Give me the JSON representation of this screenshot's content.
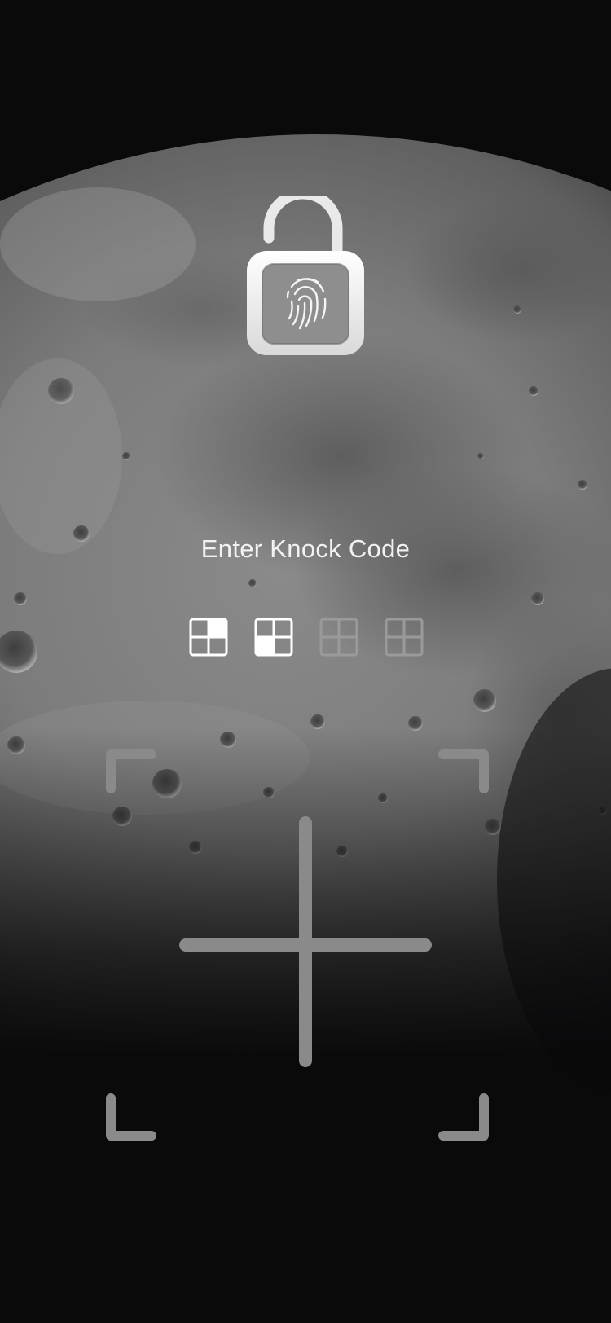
{
  "screen": {
    "wallpaper": "moon-surface",
    "accent_color": "#ffffff"
  },
  "lock": {
    "icon": "unlocked-padlock-fingerprint-icon"
  },
  "knock_code": {
    "prompt": "Enter Knock Code",
    "entered_count": 2,
    "total_count": 4,
    "entries": [
      {
        "state": "entered",
        "quadrant": "top-right"
      },
      {
        "state": "entered",
        "quadrant": "bottom-left"
      },
      {
        "state": "pending",
        "quadrant": "none"
      },
      {
        "state": "pending",
        "quadrant": "none"
      }
    ]
  },
  "knock_pad": {
    "grid": "2x2",
    "guide_color": "#8a8a8a"
  }
}
